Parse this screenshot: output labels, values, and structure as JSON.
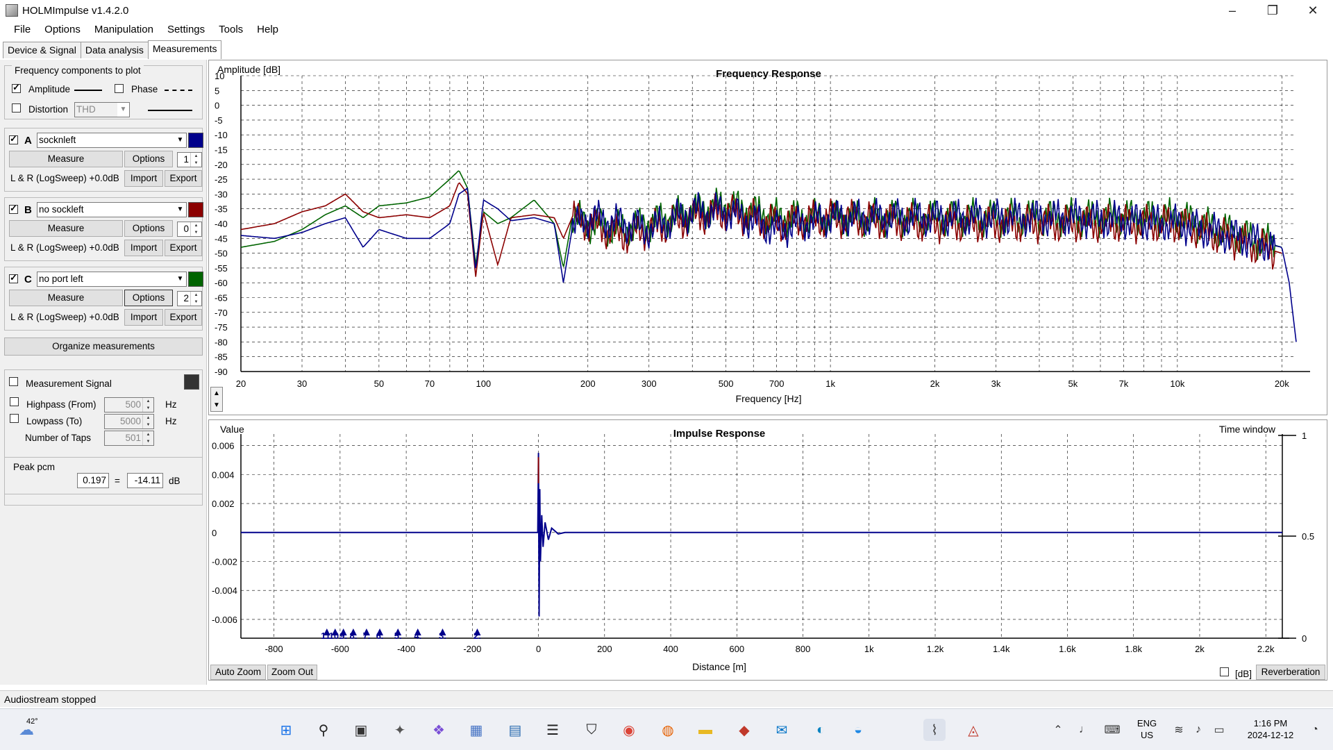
{
  "window": {
    "title": "HOLMImpulse  v1.4.2.0"
  },
  "menu": [
    "File",
    "Options",
    "Manipulation",
    "Settings",
    "Tools",
    "Help"
  ],
  "tabs": [
    "Device & Signal",
    "Data analysis",
    "Measurements"
  ],
  "freq_components": {
    "title": "Frequency components to plot",
    "amplitude_label": "Amplitude",
    "phase_label": "Phase",
    "distortion_label": "Distortion",
    "distortion_value": "THD"
  },
  "channels": [
    {
      "letter": "A",
      "name": "socknleft",
      "color": "#00008b",
      "measure": "Measure",
      "options": "Options",
      "spin": "1",
      "info": "L & R (LogSweep) +0.0dB",
      "import": "Import",
      "export": "Export"
    },
    {
      "letter": "B",
      "name": "no sockleft",
      "color": "#8b0000",
      "measure": "Measure",
      "options": "Options",
      "spin": "0",
      "info": "L & R (LogSweep) +0.0dB",
      "import": "Import",
      "export": "Export"
    },
    {
      "letter": "C",
      "name": "no port left",
      "color": "#006400",
      "measure": "Measure",
      "options": "Options",
      "spin": "2",
      "info": "L & R (LogSweep) +0.0dB",
      "import": "Import",
      "export": "Export"
    }
  ],
  "organize_label": "Organize measurements",
  "measurement_signal": {
    "label": "Measurement Signal",
    "color": "#333333"
  },
  "filters": {
    "highpass_label": "Highpass (From)",
    "highpass_value": "500",
    "lowpass_label": "Lowpass (To)",
    "lowpass_value": "5000",
    "taps_label": "Number of Taps",
    "taps_value": "501",
    "unit": "Hz"
  },
  "peak": {
    "title": "Peak pcm",
    "value": "0.197",
    "eq": "=",
    "db": "-14.11",
    "unit": "dB"
  },
  "status": "Audiostream stopped",
  "chart_data": [
    {
      "type": "line",
      "title": "Frequency Response",
      "ylabel": "Amplitude [dB]",
      "xlabel": "Frequency [Hz]",
      "xscale": "log",
      "xlim": [
        20,
        22000
      ],
      "ylim": [
        -90,
        10
      ],
      "y_ticks": [
        10,
        5,
        0,
        -5,
        -10,
        -15,
        -20,
        -25,
        -30,
        -35,
        -40,
        -45,
        -50,
        -55,
        -60,
        -65,
        -70,
        -75,
        -80,
        -85,
        -90
      ],
      "x_ticks": [
        [
          20,
          "20"
        ],
        [
          30,
          "30"
        ],
        [
          50,
          "50"
        ],
        [
          70,
          "70"
        ],
        [
          100,
          "100"
        ],
        [
          200,
          "200"
        ],
        [
          300,
          "300"
        ],
        [
          500,
          "500"
        ],
        [
          700,
          "700"
        ],
        [
          1000,
          "1k"
        ],
        [
          2000,
          "2k"
        ],
        [
          3000,
          "3k"
        ],
        [
          5000,
          "5k"
        ],
        [
          7000,
          "7k"
        ],
        [
          10000,
          "10k"
        ],
        [
          20000,
          "20k"
        ]
      ],
      "grid": true,
      "series": [
        {
          "color": "#006400",
          "x": [
            20,
            25,
            30,
            35,
            40,
            45,
            50,
            60,
            70,
            80,
            85,
            90,
            95,
            100,
            110,
            120,
            140,
            160,
            170,
            180,
            200,
            250,
            300,
            400,
            500,
            700,
            1000,
            2000,
            5000,
            10000,
            20000
          ],
          "y": [
            -48,
            -46,
            -42,
            -37,
            -34,
            -38,
            -34,
            -33,
            -31,
            -25,
            -22,
            -28,
            -54,
            -36,
            -40,
            -38,
            -32,
            -40,
            -55,
            -38,
            -40,
            -42,
            -40,
            -36,
            -34,
            -38,
            -38,
            -38,
            -38,
            -38,
            -48
          ]
        },
        {
          "color": "#8b0000",
          "x": [
            20,
            25,
            30,
            35,
            40,
            45,
            50,
            60,
            70,
            80,
            85,
            90,
            95,
            100,
            110,
            120,
            140,
            160,
            170,
            180,
            200,
            250,
            300,
            400,
            500,
            700,
            1000,
            2000,
            5000,
            10000,
            20000
          ],
          "y": [
            -42,
            -40,
            -36,
            -34,
            -30,
            -36,
            -38,
            -37,
            -38,
            -34,
            -26,
            -30,
            -58,
            -36,
            -54,
            -38,
            -37,
            -38,
            -45,
            -38,
            -40,
            -44,
            -42,
            -38,
            -36,
            -40,
            -38,
            -40,
            -40,
            -40,
            -50
          ]
        },
        {
          "color": "#00008b",
          "x": [
            20,
            25,
            30,
            35,
            40,
            45,
            50,
            60,
            70,
            80,
            85,
            90,
            95,
            100,
            110,
            120,
            140,
            160,
            170,
            180,
            200,
            250,
            300,
            400,
            500,
            700,
            1000,
            2000,
            5000,
            10000,
            20000,
            21000,
            22000
          ],
          "y": [
            -44,
            -45,
            -43,
            -40,
            -38,
            -48,
            -42,
            -45,
            -45,
            -40,
            -30,
            -28,
            -56,
            -32,
            -35,
            -39,
            -38,
            -40,
            -60,
            -42,
            -38,
            -40,
            -42,
            -36,
            -36,
            -42,
            -38,
            -38,
            -38,
            -40,
            -48,
            -60,
            -80
          ]
        }
      ]
    },
    {
      "type": "line",
      "title": "Impulse Response",
      "ylabel": "Value",
      "xlabel": "Distance [m]",
      "right_label": "Time window",
      "xlim": [
        -900,
        2250
      ],
      "ylim": [
        -0.0073,
        0.0068
      ],
      "y_ticks": [
        [
          "0.006",
          0.006
        ],
        [
          "0.004",
          0.004
        ],
        [
          "0.002",
          0.002
        ],
        [
          "0",
          0
        ],
        [
          "-0.002",
          -0.002
        ],
        [
          "-0.004",
          -0.004
        ],
        [
          "-0.006",
          -0.006
        ]
      ],
      "x_ticks": [
        [
          "-800",
          -800
        ],
        [
          "-600",
          -600
        ],
        [
          "-400",
          -400
        ],
        [
          "-200",
          -200
        ],
        [
          "0",
          0
        ],
        [
          "200",
          200
        ],
        [
          "400",
          400
        ],
        [
          "600",
          600
        ],
        [
          "800",
          800
        ],
        [
          "1k",
          1000
        ],
        [
          "1.2k",
          1200
        ],
        [
          "1.4k",
          1400
        ],
        [
          "1.6k",
          1600
        ],
        [
          "1.8k",
          1800
        ],
        [
          "2k",
          2000
        ],
        [
          "2.2k",
          2200
        ]
      ],
      "right_ticks": [
        "1",
        "0.5",
        "0"
      ],
      "grid": true,
      "markers": [
        {
          "label": "11.",
          "x": -640
        },
        {
          "label": "10.",
          "x": -615
        },
        {
          "label": "9.",
          "x": -590
        },
        {
          "label": "8.",
          "x": -560
        },
        {
          "label": "7.",
          "x": -520
        },
        {
          "label": "6.",
          "x": -480
        },
        {
          "label": "5.",
          "x": -425
        },
        {
          "label": "4.",
          "x": -365
        },
        {
          "label": "3.",
          "x": -290
        },
        {
          "label": "2.",
          "x": -185
        }
      ],
      "series": [
        {
          "color": "#00008b",
          "x": [
            -900,
            -2,
            0,
            2,
            4,
            6,
            10,
            14,
            20,
            30,
            40,
            60,
            80,
            2250
          ],
          "y": [
            0,
            0,
            0.0055,
            -0.0058,
            0.003,
            -0.002,
            0.0012,
            -0.001,
            0.0007,
            -0.0005,
            0.0003,
            -0.0001,
            0,
            0
          ]
        }
      ]
    }
  ],
  "buttons": {
    "auto_zoom": "Auto Zoom",
    "zoom_out": "Zoom Out",
    "db": "[dB]",
    "reverberation": "Reverberation"
  },
  "taskbar": {
    "weather": "42°",
    "lang1": "ENG",
    "lang2": "US",
    "time": "1:16 PM",
    "date": "2024-12-12"
  }
}
